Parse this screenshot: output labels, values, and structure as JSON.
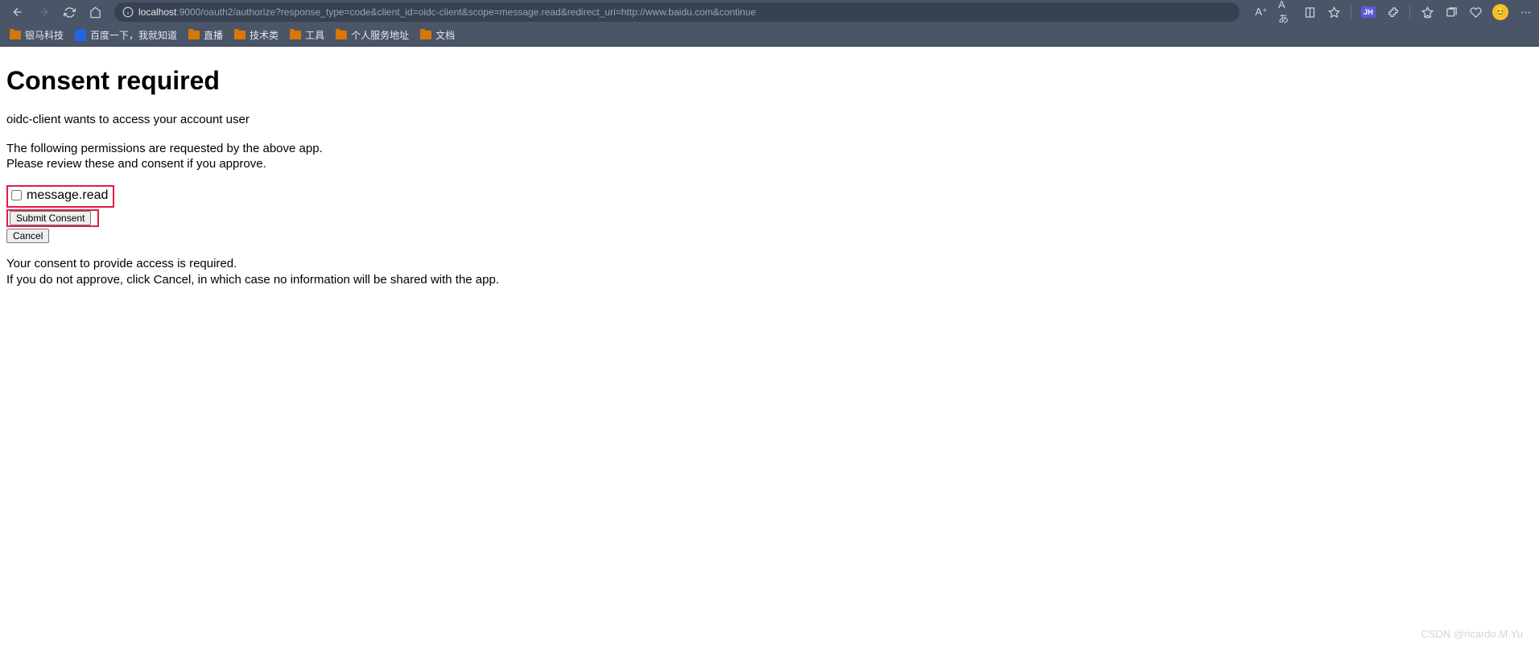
{
  "browser": {
    "url_host": "localhost",
    "url_rest": ":9000/oauth2/authorize?response_type=code&client_id=oidc-client&scope=message.read&redirect_uri=http://www.baidu.com&continue",
    "read_aloud": "Aあ",
    "font_indicator": "A⁺",
    "profile_badge": "JH"
  },
  "bookmarks": [
    {
      "type": "folder",
      "label": "银马科技"
    },
    {
      "type": "baidu",
      "label": "百度一下，我就知道"
    },
    {
      "type": "folder",
      "label": "直播"
    },
    {
      "type": "folder",
      "label": "技术类"
    },
    {
      "type": "folder",
      "label": "工具"
    },
    {
      "type": "folder",
      "label": "个人服务地址"
    },
    {
      "type": "folder",
      "label": "文档"
    }
  ],
  "page": {
    "heading": "Consent required",
    "intro": "oidc-client wants to access your account user",
    "permissions_line1": "The following permissions are requested by the above app.",
    "permissions_line2": "Please review these and consent if you approve.",
    "scope_label": "message.read",
    "submit_label": "Submit Consent",
    "cancel_label": "Cancel",
    "footer_line1": "Your consent to provide access is required.",
    "footer_line2": "If you do not approve, click Cancel, in which case no information will be shared with the app."
  },
  "watermark": "CSDN @ricardo.M.Yu"
}
